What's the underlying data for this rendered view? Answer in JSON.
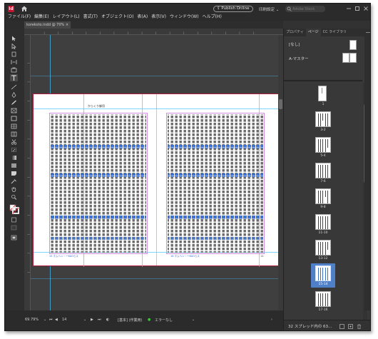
{
  "app": {
    "logo": "Id",
    "publish_label": "Publish Online",
    "workspace_label": "印刷設定 ⌄",
    "search_placeholder": "Adobe Stock"
  },
  "menu": [
    "ファイル(F)",
    "編集(E)",
    "レイアウト(L)",
    "書式(T)",
    "オブジェクト(O)",
    "表(A)",
    "表示(V)",
    "ウィンドウ(W)",
    "ヘルプ(H)"
  ],
  "document_tab": "korekoto.indd @ 70% ×",
  "document": {
    "running_head": "からくり御用",
    "folio_left": "15 ホムヘン・ーKAOらス",
    "folio_right": "16 ホムヘン・ーKAOらス",
    "page_number_right": "14"
  },
  "status": {
    "zoom": "69.79%",
    "page": "14",
    "style": "[基本] (作業用)",
    "errors": "エラーなし"
  },
  "panel": {
    "tabs": [
      "プロパティ",
      "ページ",
      "CC ライブラリ"
    ],
    "active_tab": 1,
    "master_none": "[なし]",
    "master_a": "A-マスター",
    "spreads": [
      {
        "label": "1"
      },
      {
        "label": "3-2"
      },
      {
        "label": "5-4"
      },
      {
        "label": "7-6"
      },
      {
        "label": "9-8"
      },
      {
        "label": "11-10"
      },
      {
        "label": "13-12"
      },
      {
        "label": "15-14",
        "selected": true
      },
      {
        "label": "17-16"
      }
    ],
    "footer": "32 スプレッド内の 63..."
  },
  "colors": {
    "accent": "#47c4ff",
    "selection": "#4f7fc6",
    "brand": "#c0142e"
  }
}
